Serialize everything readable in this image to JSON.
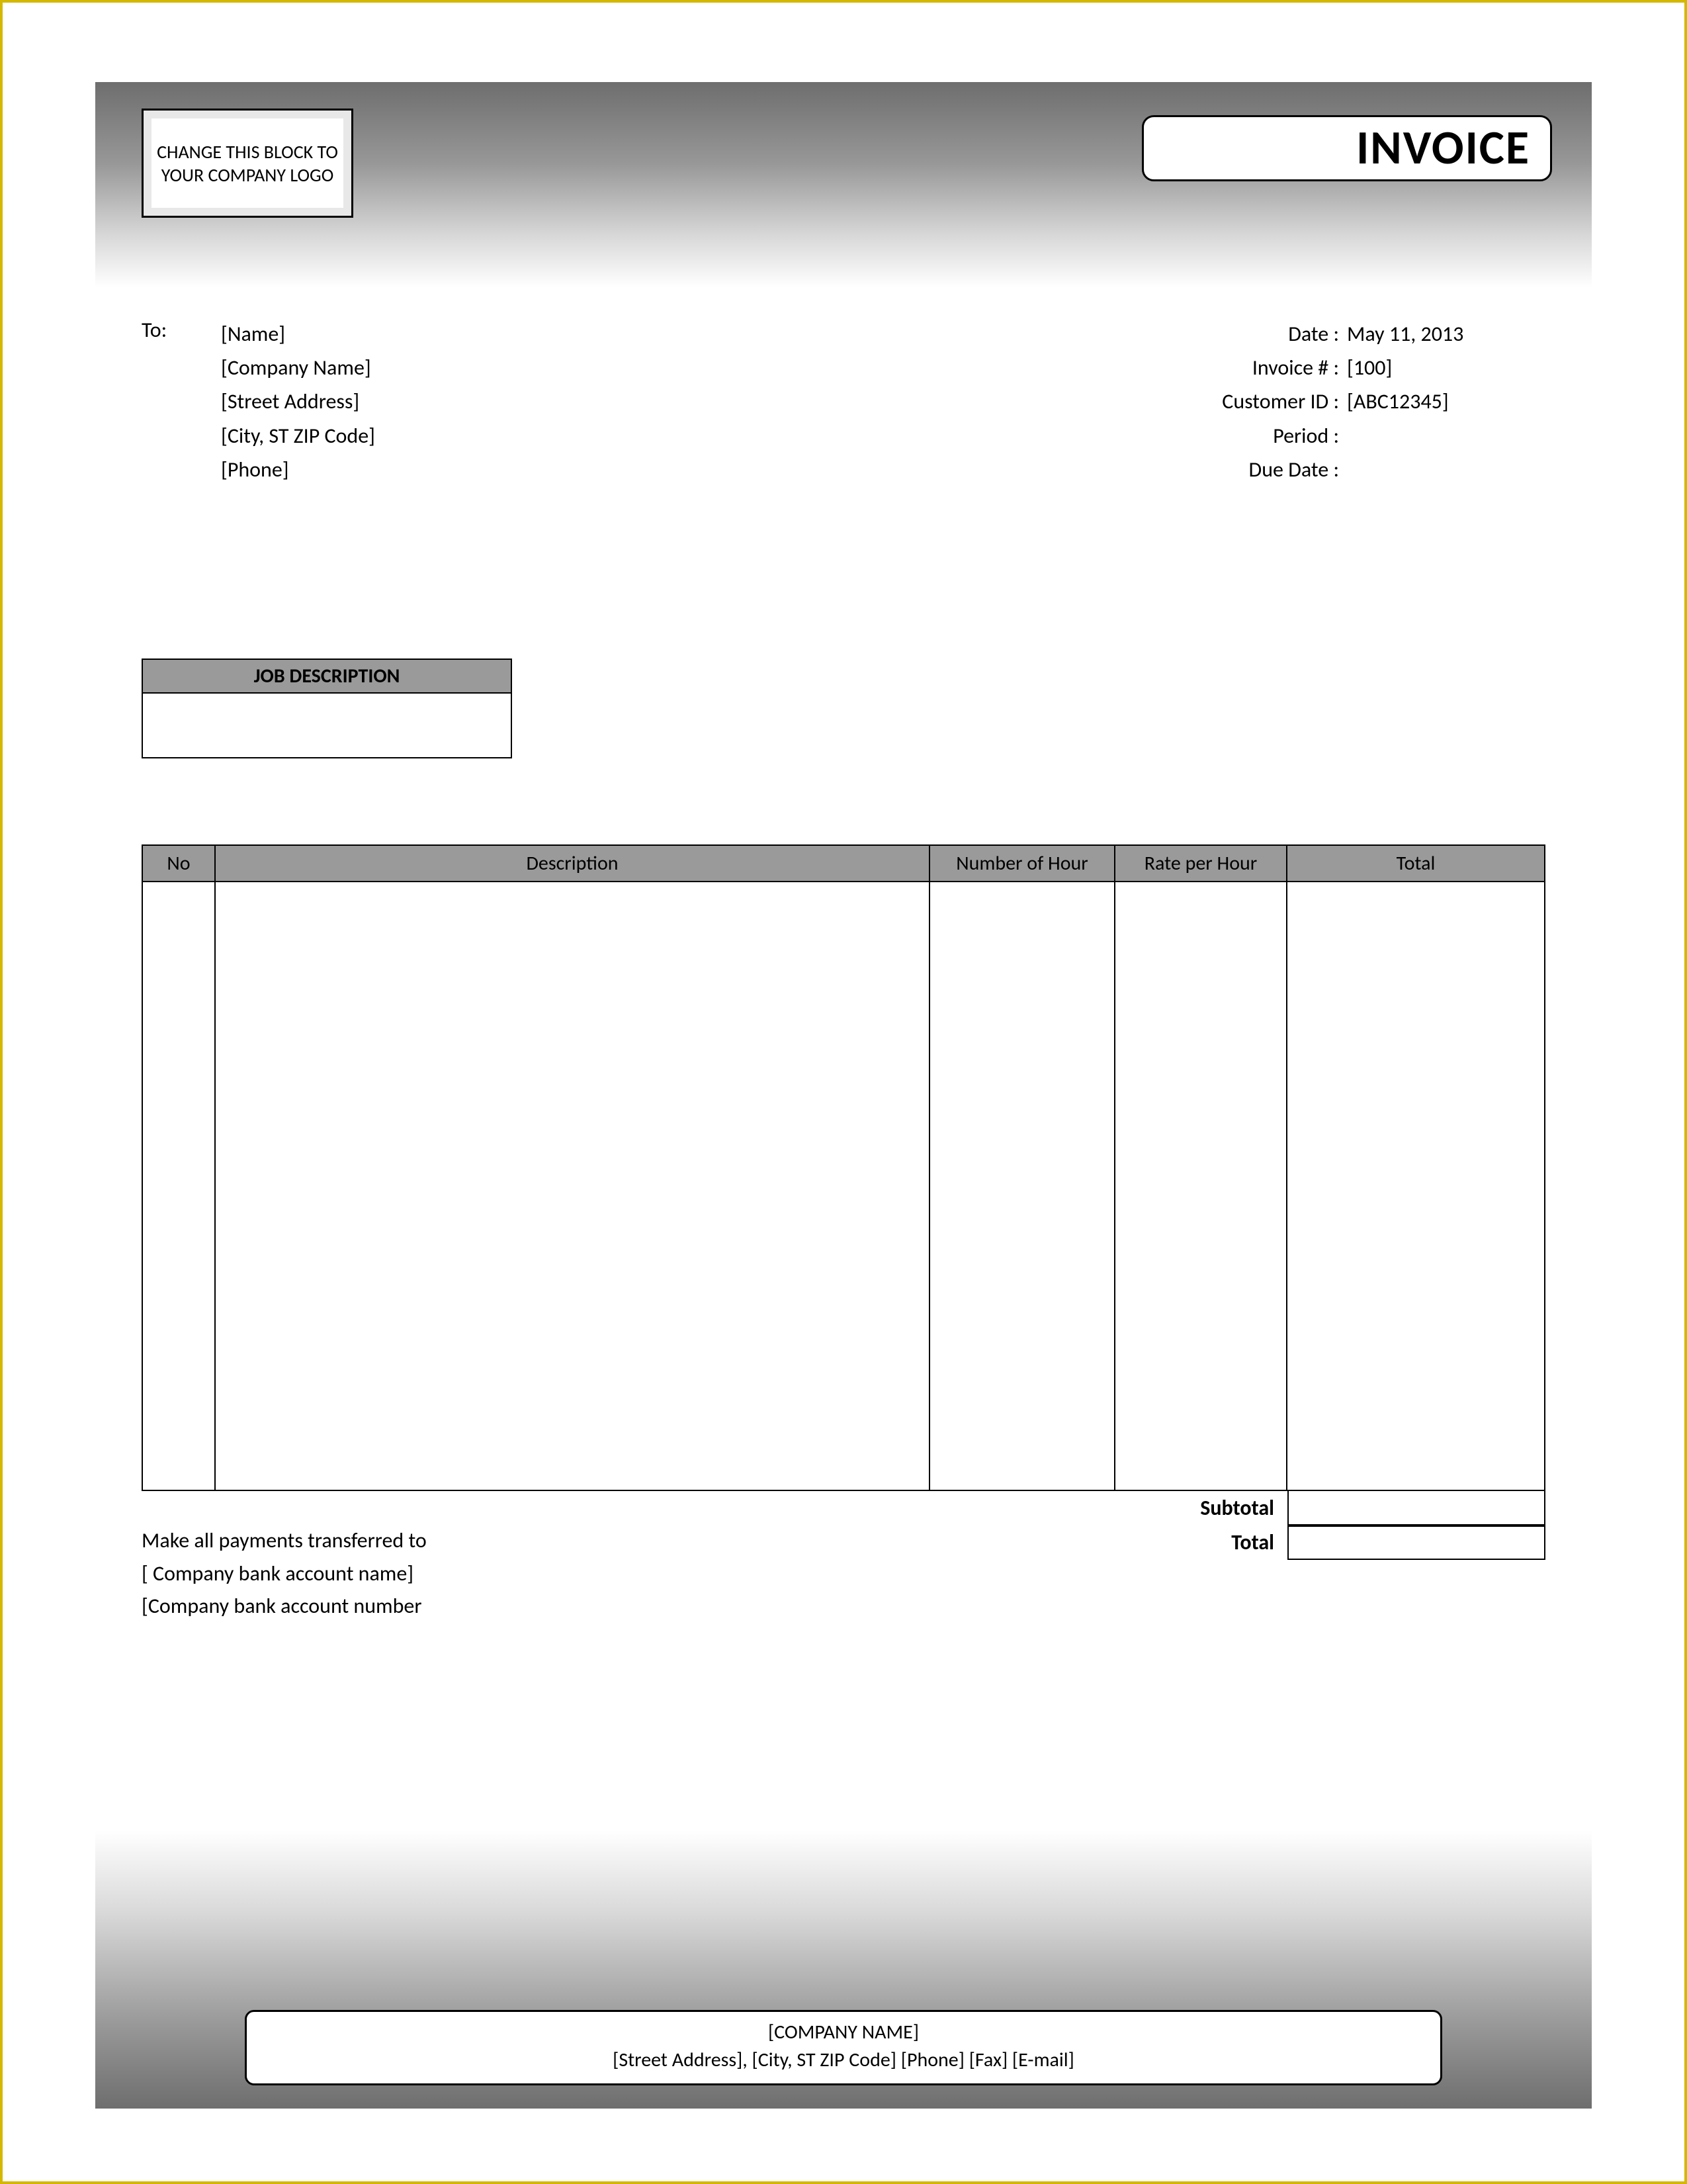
{
  "header": {
    "logo_text": "CHANGE THIS BLOCK TO YOUR COMPANY LOGO",
    "title": "INVOICE"
  },
  "to": {
    "label": "To:",
    "name": "[Name]",
    "company": "[Company Name]",
    "street": "[Street Address]",
    "city": "[City, ST  ZIP Code]",
    "phone": "[Phone]"
  },
  "meta": {
    "date_label": "Date :",
    "date_value": "May 11, 2013",
    "invoice_no_label": "Invoice # :",
    "invoice_no_value": "[100]",
    "customer_id_label": "Customer ID :",
    "customer_id_value": "[ABC12345]",
    "period_label": "Period :",
    "period_value": "",
    "due_date_label": "Due Date :",
    "due_date_value": ""
  },
  "job": {
    "header": "JOB DESCRIPTION",
    "body": ""
  },
  "columns": {
    "no": "No",
    "description": "Description",
    "hours": "Number of Hour",
    "rate": "Rate per Hour",
    "total": "Total"
  },
  "totals": {
    "subtotal_label": "Subtotal",
    "subtotal_value": "",
    "total_label": "Total",
    "total_value": ""
  },
  "payment": {
    "line1": "Make all payments transferred to",
    "line2": "[ Company bank account name]",
    "line3": "[Company bank account number"
  },
  "footer": {
    "company": "[COMPANY NAME]",
    "details": "[Street Address], [City, ST  ZIP Code]  [Phone]  [Fax]  [E-mail]"
  }
}
